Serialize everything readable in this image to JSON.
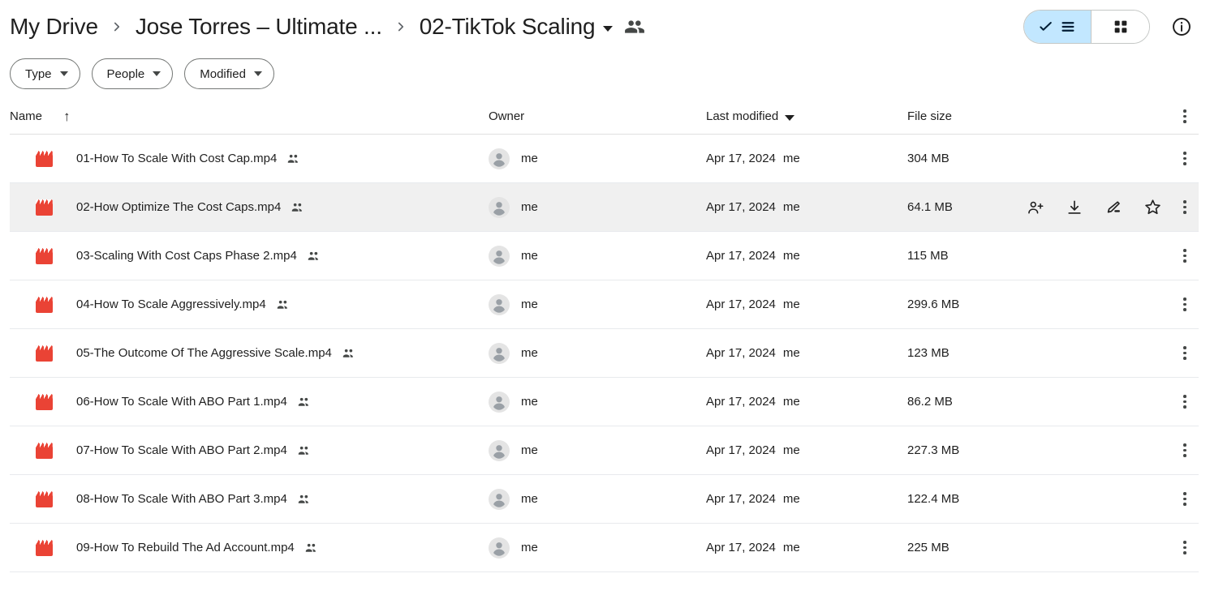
{
  "breadcrumb": {
    "root": "My Drive",
    "parent": "Jose Torres – Ultimate ...",
    "current": "02-TikTok Scaling",
    "separator": "chevron-right-icon",
    "shared_icon": "people-shared-icon"
  },
  "toolbar": {
    "view_list_label": "list-view",
    "view_grid_label": "grid-view",
    "info_label": "details-info",
    "active_view": "list"
  },
  "filters": [
    {
      "label": "Type"
    },
    {
      "label": "People"
    },
    {
      "label": "Modified"
    }
  ],
  "table": {
    "columns": {
      "name": "Name",
      "owner": "Owner",
      "modified": "Last modified",
      "size": "File size"
    },
    "sort": {
      "column": "Name",
      "direction": "asc",
      "glyph": "↑"
    },
    "rows": [
      {
        "name": "01-How To Scale With Cost Cap.mp4",
        "shared": true,
        "owner": "me",
        "modified_date": "Apr 17, 2024",
        "modified_by": "me",
        "size": "304 MB",
        "hovered": false
      },
      {
        "name": "02-How Optimize The Cost Caps.mp4",
        "shared": true,
        "owner": "me",
        "modified_date": "Apr 17, 2024",
        "modified_by": "me",
        "size": "64.1 MB",
        "hovered": true
      },
      {
        "name": "03-Scaling With Cost Caps Phase 2.mp4",
        "shared": true,
        "owner": "me",
        "modified_date": "Apr 17, 2024",
        "modified_by": "me",
        "size": "115 MB",
        "hovered": false
      },
      {
        "name": "04-How To Scale Aggressively.mp4",
        "shared": true,
        "owner": "me",
        "modified_date": "Apr 17, 2024",
        "modified_by": "me",
        "size": "299.6 MB",
        "hovered": false
      },
      {
        "name": "05-The Outcome Of The Aggressive Scale.mp4",
        "shared": true,
        "owner": "me",
        "modified_date": "Apr 17, 2024",
        "modified_by": "me",
        "size": "123 MB",
        "hovered": false
      },
      {
        "name": "06-How To Scale With ABO Part 1.mp4",
        "shared": true,
        "owner": "me",
        "modified_date": "Apr 17, 2024",
        "modified_by": "me",
        "size": "86.2 MB",
        "hovered": false
      },
      {
        "name": "07-How To Scale With ABO Part 2.mp4",
        "shared": true,
        "owner": "me",
        "modified_date": "Apr 17, 2024",
        "modified_by": "me",
        "size": "227.3 MB",
        "hovered": false
      },
      {
        "name": "08-How To Scale With ABO Part 3.mp4",
        "shared": true,
        "owner": "me",
        "modified_date": "Apr 17, 2024",
        "modified_by": "me",
        "size": "122.4 MB",
        "hovered": false
      },
      {
        "name": "09-How To Rebuild The Ad Account.mp4",
        "shared": true,
        "owner": "me",
        "modified_date": "Apr 17, 2024",
        "modified_by": "me",
        "size": "225 MB",
        "hovered": false
      }
    ],
    "row_actions": [
      "share-add-person-icon",
      "download-icon",
      "edit-pencil-icon",
      "star-icon",
      "more-options-icon"
    ],
    "file_icon": "video-clapperboard-icon"
  },
  "colors": {
    "video_icon_red": "#ea4335",
    "active_toggle_blue": "#c2e7ff",
    "row_hover_gray": "#f0f0f0",
    "text_primary": "#1f1f1f",
    "border": "#e8eaed"
  }
}
